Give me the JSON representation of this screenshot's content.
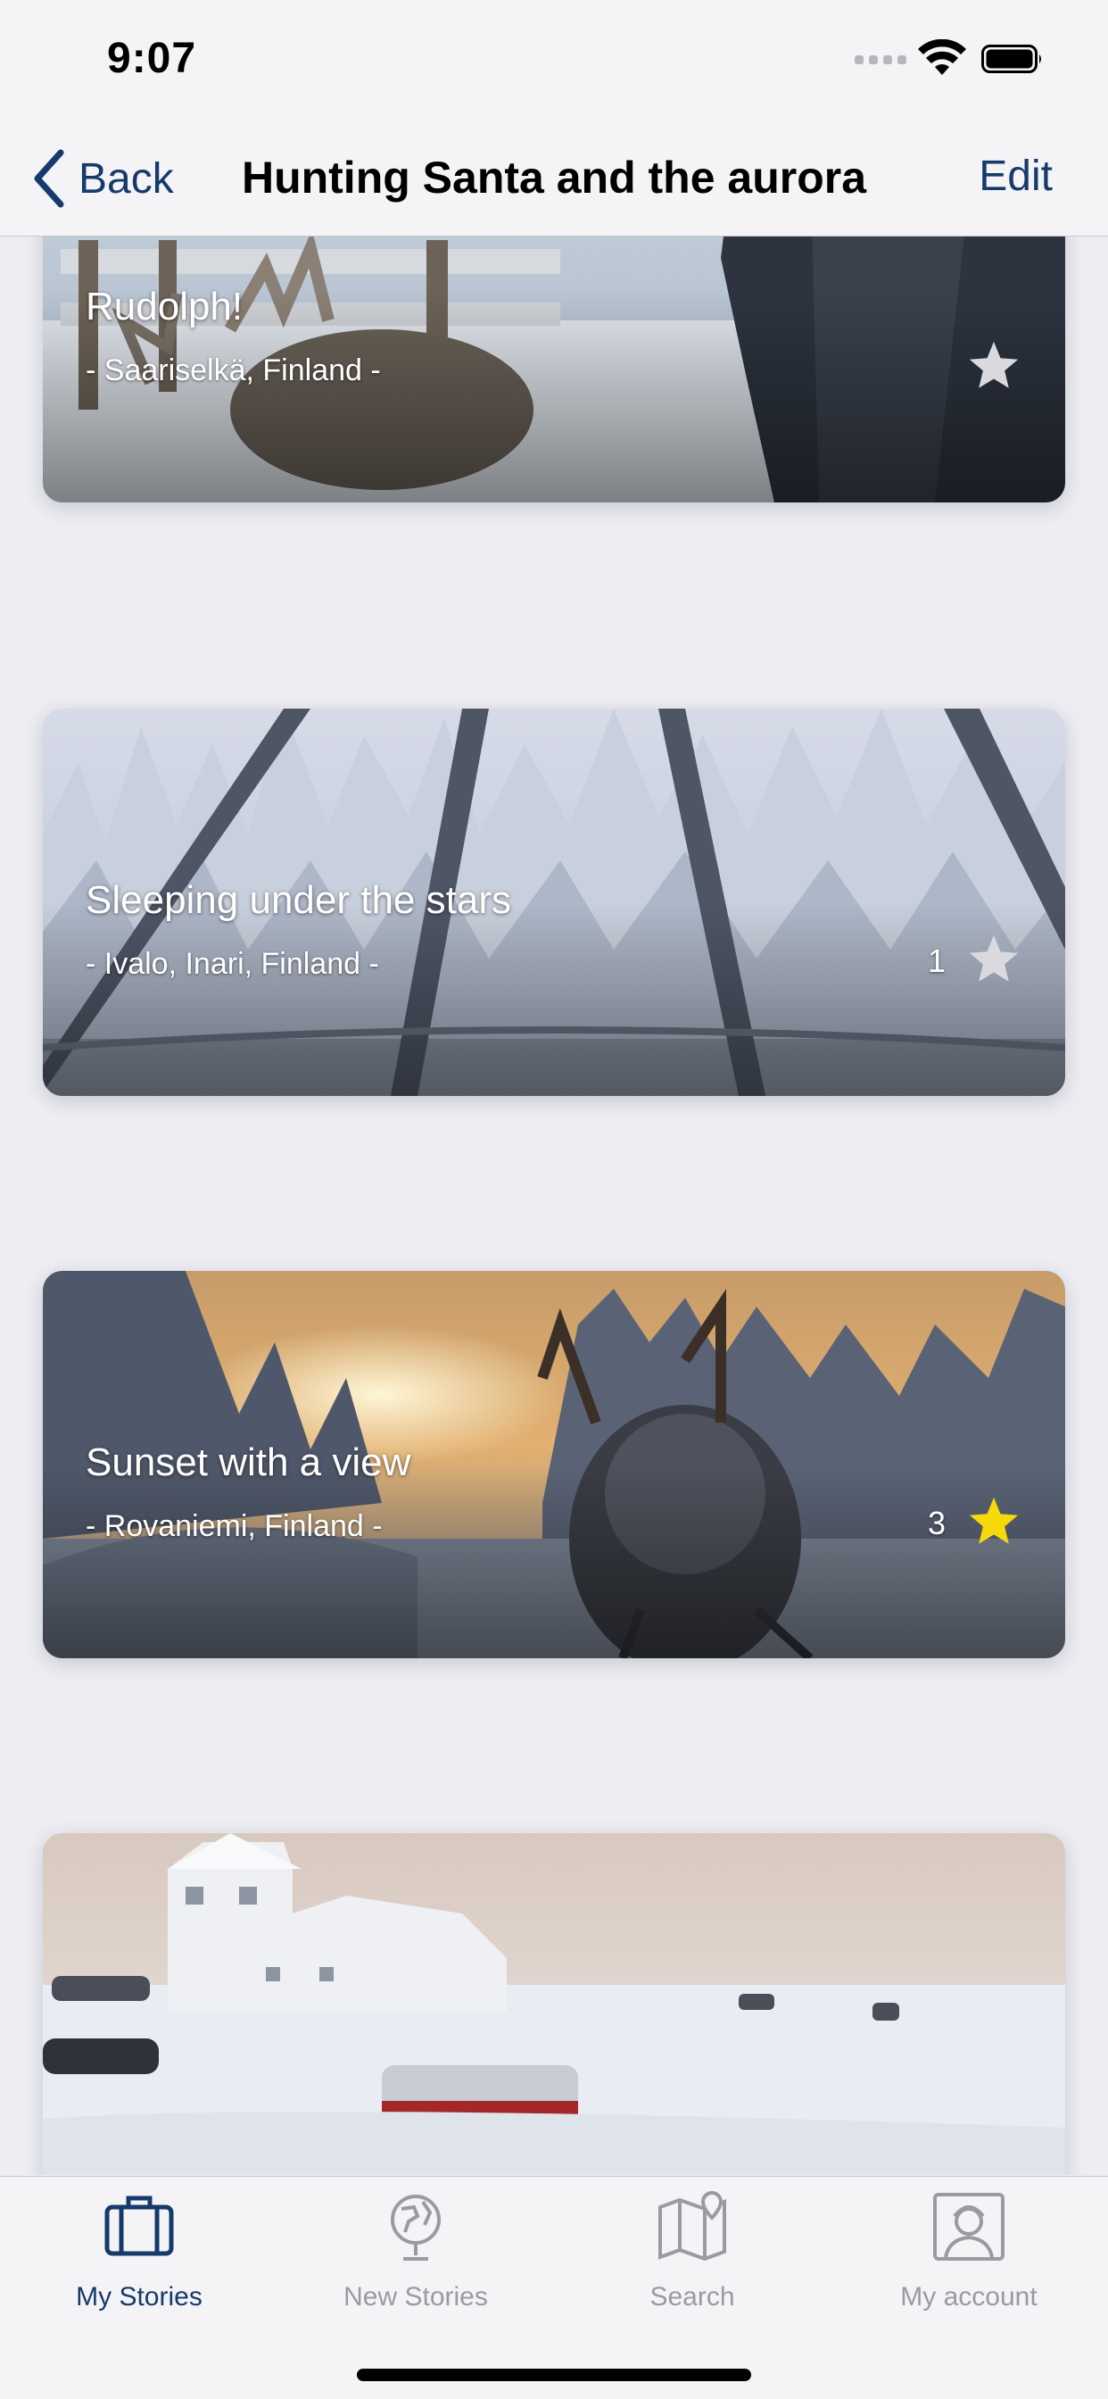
{
  "status_bar": {
    "time": "9:07"
  },
  "nav": {
    "back_label": "Back",
    "title": "Hunting Santa and the aurora",
    "edit_label": "Edit"
  },
  "stories": [
    {
      "title": "Rudolph!",
      "location": "- Saariselkä, Finland -",
      "count": "",
      "starred": false
    },
    {
      "title": "Sleeping under the stars",
      "location": "- Ivalo, Inari, Finland -",
      "count": "1",
      "starred": false
    },
    {
      "title": "Sunset with a view",
      "location": "- Rovaniemi, Finland -",
      "count": "3",
      "starred": true
    },
    {
      "title": "",
      "location": "",
      "count": "",
      "starred": false
    }
  ],
  "tab_bar": {
    "tabs": [
      {
        "label": "My Stories",
        "icon": "suitcase-icon",
        "active": true
      },
      {
        "label": "New Stories",
        "icon": "globe-icon",
        "active": false
      },
      {
        "label": "Search",
        "icon": "map-pin-icon",
        "active": false
      },
      {
        "label": "My account",
        "icon": "user-icon",
        "active": false
      }
    ]
  },
  "colors": {
    "accent": "#163a6b",
    "inactive": "#9a9aa0",
    "star_active": "#f5d90a",
    "star_inactive": "#d9d9de"
  }
}
